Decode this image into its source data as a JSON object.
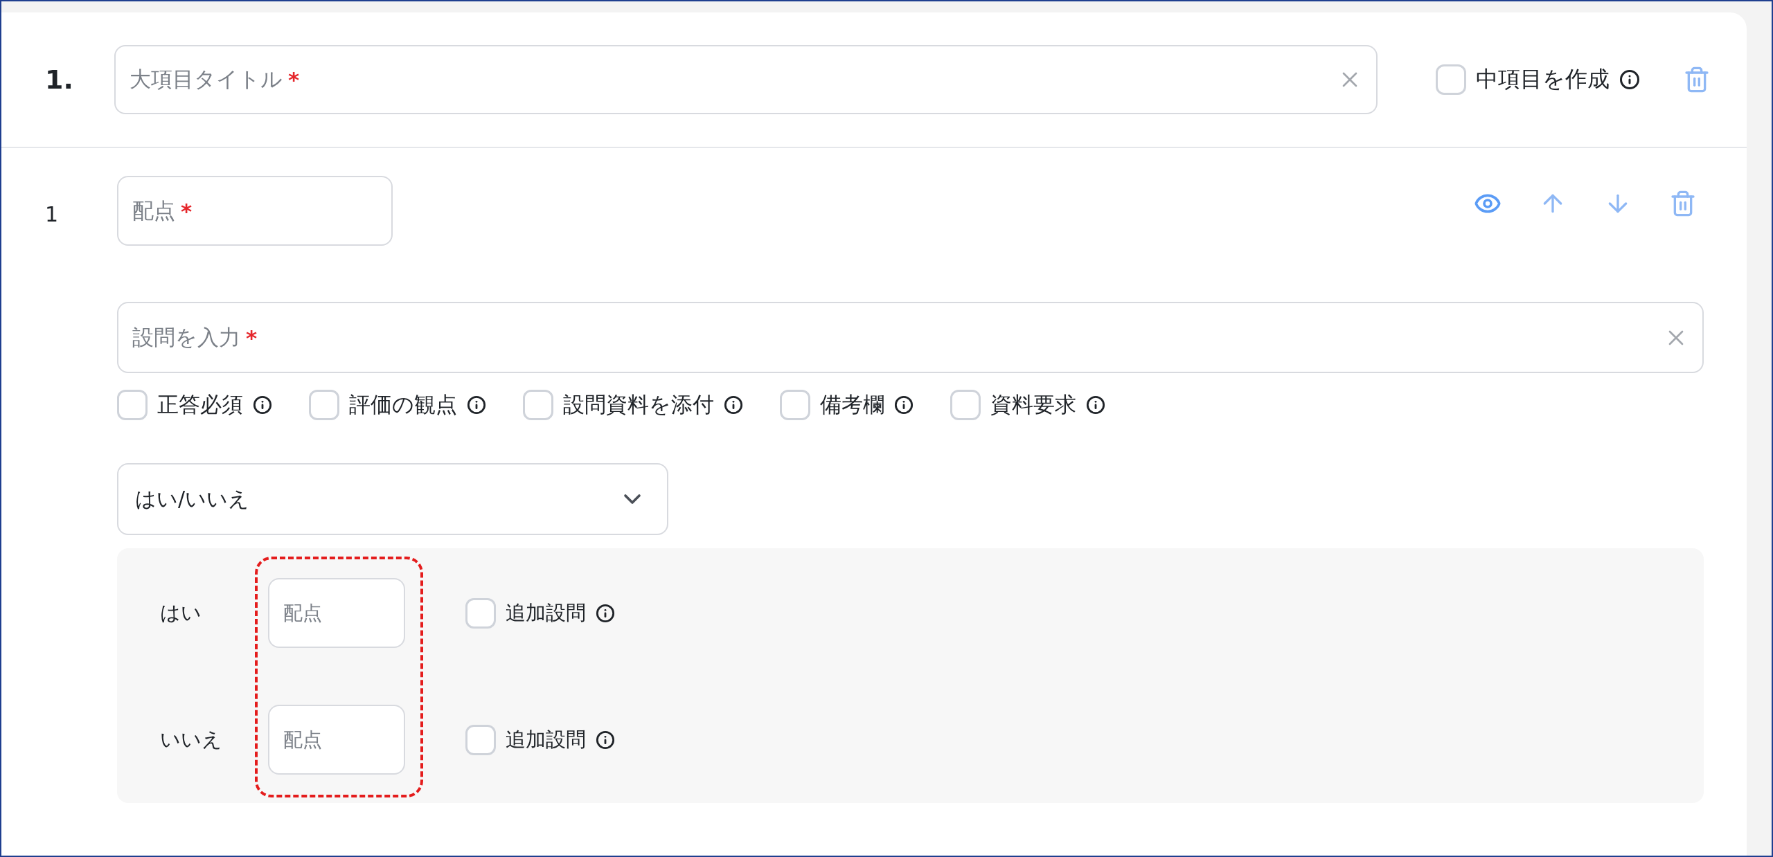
{
  "section": {
    "number": "1.",
    "title_field": {
      "placeholder": "大項目タイトル",
      "required_mark": "*"
    },
    "create_sub": {
      "label": "中項目を作成",
      "checked": false
    }
  },
  "question": {
    "number": "1",
    "score_field": {
      "placeholder": "配点",
      "required_mark": "*"
    },
    "text_field": {
      "placeholder": "設問を入力",
      "required_mark": "*"
    },
    "options": [
      {
        "label": "正答必須",
        "checked": false
      },
      {
        "label": "評価の観点",
        "checked": false
      },
      {
        "label": "設問資料を添付",
        "checked": false
      },
      {
        "label": "備考欄",
        "checked": false
      },
      {
        "label": "資料要求",
        "checked": false
      }
    ],
    "answer_type": {
      "value": "はい/いいえ"
    },
    "choices_highlighted": true,
    "choices": [
      {
        "label": "はい",
        "score_placeholder": "配点",
        "followup": {
          "label": "追加設問",
          "checked": false
        }
      },
      {
        "label": "いいえ",
        "score_placeholder": "配点",
        "followup": {
          "label": "追加設問",
          "checked": false
        }
      }
    ]
  }
}
